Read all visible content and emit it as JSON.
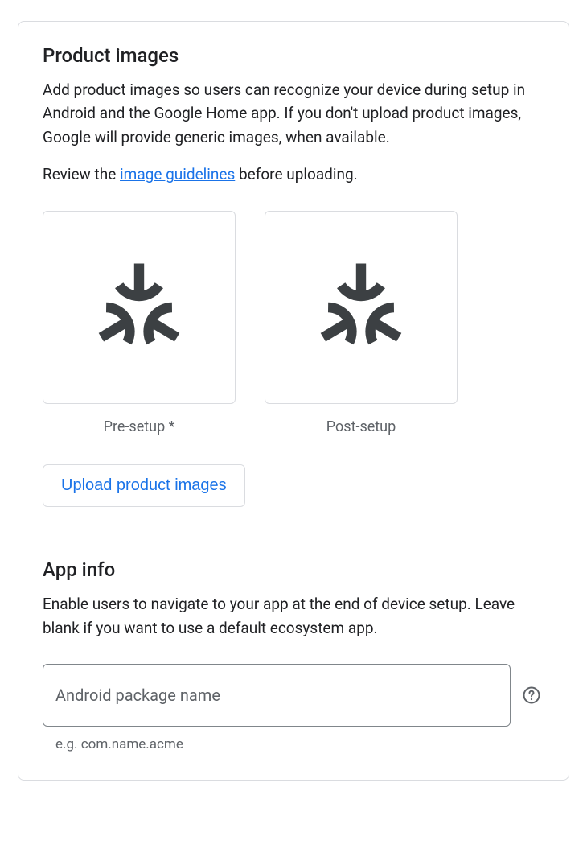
{
  "productImages": {
    "title": "Product images",
    "description": "Add product images so users can recognize your device during setup in Android and the Google Home app. If you don't upload product images, Google will provide generic images, when available.",
    "reviewPrefix": "Review the ",
    "guidelinesLink": "image guidelines",
    "reviewSuffix": " before uploading.",
    "slots": [
      {
        "caption": "Pre-setup *"
      },
      {
        "caption": "Post-setup"
      }
    ],
    "uploadButton": "Upload product images"
  },
  "appInfo": {
    "title": "App info",
    "description": "Enable users to navigate to your app at the end of device setup. Leave blank if you want to use a default ecosystem app.",
    "packageField": {
      "label": "Android package name",
      "value": "",
      "hint": "e.g. com.name.acme"
    }
  }
}
